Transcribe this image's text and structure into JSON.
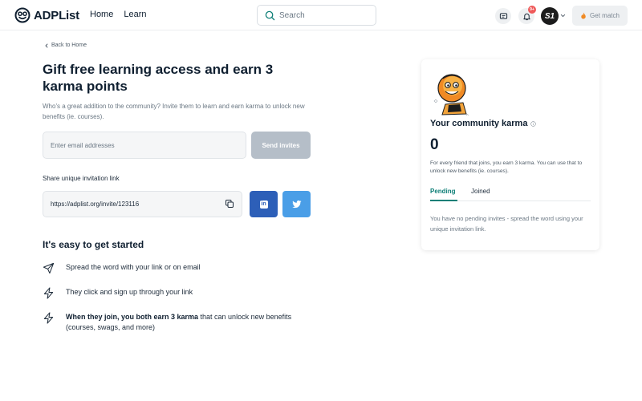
{
  "header": {
    "brand": "ADPList",
    "nav": [
      "Home",
      "Learn"
    ],
    "search_placeholder": "Search",
    "notification_badge": "9+",
    "avatar_initials": "S1",
    "get_match_label": "Get match",
    "icons": [
      "smiley-logo-icon",
      "search-icon",
      "message-icon",
      "bell-icon",
      "chevron-down-icon",
      "fire-icon"
    ]
  },
  "main": {
    "back_label": "Back to Home",
    "title": "Gift free learning access and earn 3 karma points",
    "description": "Who's a great addition to the community? Invite them to learn and earn karma to unlock new benefits (ie. courses).",
    "email_placeholder": "Enter email addresses",
    "send_label": "Send invites",
    "share_label": "Share unique invitation link",
    "invite_link": "https://adplist.org/invite/123116",
    "linkedin_glyph": "in",
    "easy_title": "It's easy to get started",
    "steps": [
      {
        "icon": "send-icon",
        "text": "Spread the word with your link or on email"
      },
      {
        "icon": "lightning-icon",
        "text": "They click and sign up through your link"
      },
      {
        "icon": "lightning-icon",
        "strong": "When they join, you both earn 3 karma",
        "text": " that can unlock new benefits (courses, swags, and more)"
      }
    ]
  },
  "karma_card": {
    "title": "Your community karma",
    "count": "0",
    "description": "For every friend that joins, you earn 3 karma. You can use that to unlock new benefits (ie. courses).",
    "tabs": [
      "Pending",
      "Joined"
    ],
    "active_tab": "Pending",
    "pending_message": "You have no pending invites - spread the word using your unique invitation link."
  },
  "colors": {
    "accent": "#0e7f77",
    "linkedin": "#2d5fb8",
    "twitter": "#4a9ee7",
    "send_disabled": "#b5bec8",
    "badge": "#ef5a5a"
  }
}
